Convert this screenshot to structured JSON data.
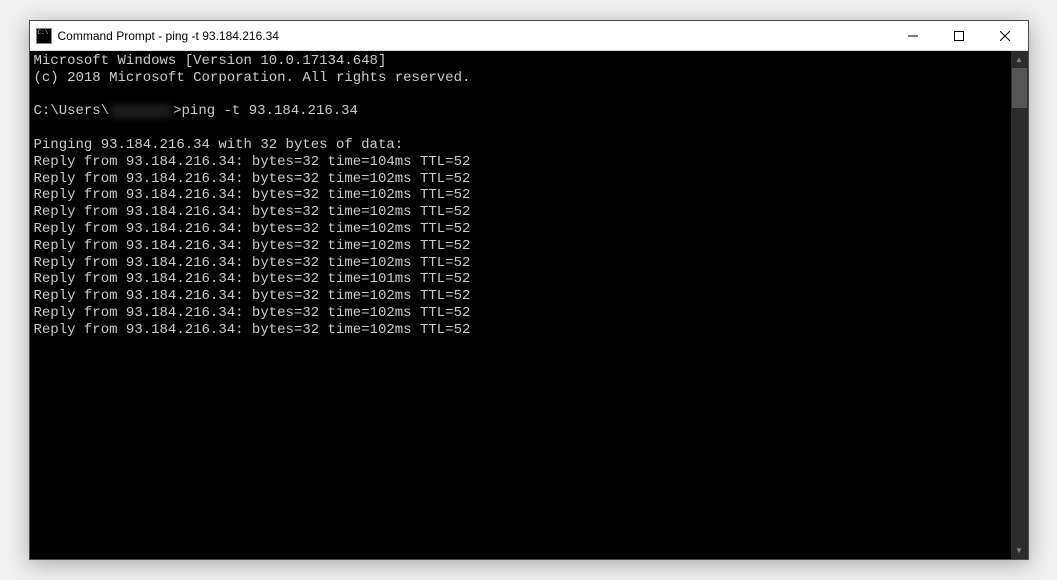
{
  "window": {
    "title": "Command Prompt - ping  -t 93.184.216.34"
  },
  "terminal": {
    "header_line1": "Microsoft Windows [Version 10.0.17134.648]",
    "header_line2": "(c) 2018 Microsoft Corporation. All rights reserved.",
    "prompt_prefix": "C:\\Users\\",
    "prompt_suffix": ">ping -t 93.184.216.34",
    "ping_header": "Pinging 93.184.216.34 with 32 bytes of data:",
    "replies": [
      "Reply from 93.184.216.34: bytes=32 time=104ms TTL=52",
      "Reply from 93.184.216.34: bytes=32 time=102ms TTL=52",
      "Reply from 93.184.216.34: bytes=32 time=102ms TTL=52",
      "Reply from 93.184.216.34: bytes=32 time=102ms TTL=52",
      "Reply from 93.184.216.34: bytes=32 time=102ms TTL=52",
      "Reply from 93.184.216.34: bytes=32 time=102ms TTL=52",
      "Reply from 93.184.216.34: bytes=32 time=102ms TTL=52",
      "Reply from 93.184.216.34: bytes=32 time=101ms TTL=52",
      "Reply from 93.184.216.34: bytes=32 time=102ms TTL=52",
      "Reply from 93.184.216.34: bytes=32 time=102ms TTL=52",
      "Reply from 93.184.216.34: bytes=32 time=102ms TTL=52"
    ]
  }
}
